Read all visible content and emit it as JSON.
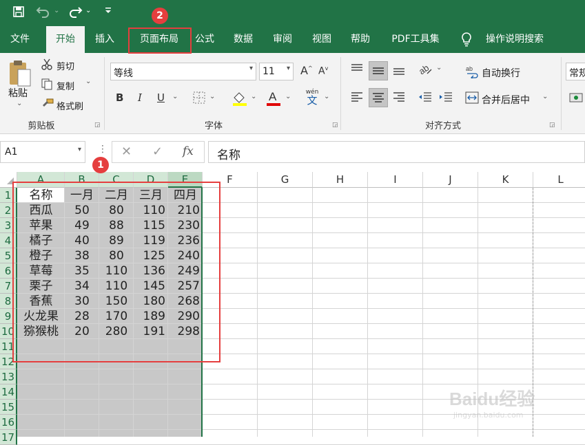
{
  "quick_access": {
    "save_icon": "save-icon",
    "undo_icon": "undo-icon",
    "redo_icon": "redo-icon",
    "customize_icon": "customize-icon"
  },
  "tabs": [
    {
      "label": "文件"
    },
    {
      "label": "开始"
    },
    {
      "label": "插入"
    },
    {
      "label": "页面布局"
    },
    {
      "label": "公式"
    },
    {
      "label": "数据"
    },
    {
      "label": "审阅"
    },
    {
      "label": "视图"
    },
    {
      "label": "帮助"
    },
    {
      "label": "PDF工具集"
    },
    {
      "label": "操作说明搜索"
    }
  ],
  "ribbon": {
    "clipboard": {
      "paste": "粘贴",
      "cut": "剪切",
      "copy": "复制",
      "format_painter": "格式刷",
      "group": "剪贴板"
    },
    "font": {
      "name": "等线",
      "size": "11",
      "bold": "B",
      "italic": "I",
      "underline": "U",
      "wen": "wén",
      "wen_char": "文",
      "group": "字体"
    },
    "alignment": {
      "wrap": "自动换行",
      "merge": "合并后居中",
      "group": "对齐方式"
    },
    "number": {
      "format": "常规"
    }
  },
  "formula_bar": {
    "name_box": "A1",
    "fx": "fx",
    "content": "名称"
  },
  "columns": [
    "A",
    "B",
    "C",
    "D",
    "E",
    "F",
    "G",
    "H",
    "I",
    "J",
    "K",
    "L"
  ],
  "rows": [
    "1",
    "2",
    "3",
    "4",
    "5",
    "6",
    "7",
    "8",
    "9",
    "10",
    "11",
    "12",
    "13",
    "14",
    "15",
    "16",
    "17"
  ],
  "table": {
    "headers": [
      "名称",
      "一月",
      "二月",
      "三月",
      "四月"
    ],
    "rows": [
      [
        "西瓜",
        "50",
        "80",
        "110",
        "210"
      ],
      [
        "苹果",
        "49",
        "88",
        "115",
        "230"
      ],
      [
        "橘子",
        "40",
        "89",
        "119",
        "236"
      ],
      [
        "橙子",
        "38",
        "80",
        "125",
        "240"
      ],
      [
        "草莓",
        "35",
        "110",
        "136",
        "249"
      ],
      [
        "栗子",
        "34",
        "110",
        "145",
        "257"
      ],
      [
        "香蕉",
        "30",
        "150",
        "180",
        "268"
      ],
      [
        "火龙果",
        "28",
        "170",
        "189",
        "290"
      ],
      [
        "猕猴桃",
        "20",
        "280",
        "191",
        "298"
      ]
    ]
  },
  "annotations": {
    "badge1": "1",
    "badge2": "2"
  },
  "watermark": {
    "brand": "Baidu经验",
    "url": "jingyan.baidu.com"
  },
  "colors": {
    "accent": "#217346",
    "selection": "#c8c8c8",
    "annotation": "#e53e3e"
  }
}
